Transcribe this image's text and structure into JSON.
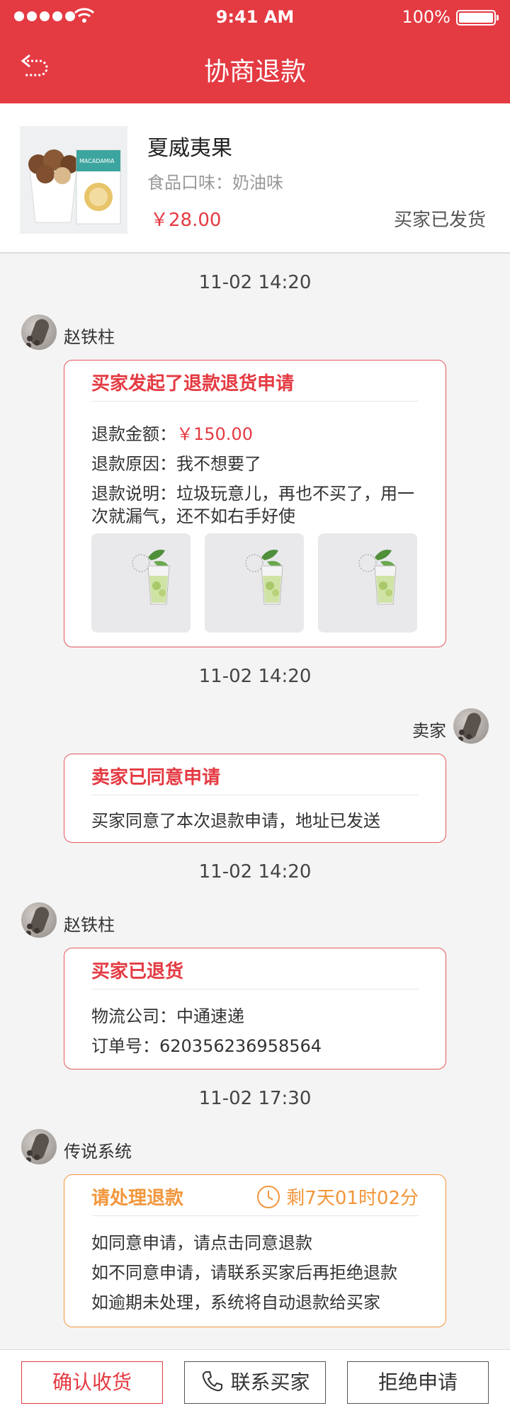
{
  "status": {
    "time": "9:41 AM",
    "battery": "100%"
  },
  "header": {
    "title": "协商退款"
  },
  "product": {
    "name": "夏威夷果",
    "flavor": "食品口味：奶油味",
    "price": "￥28.00",
    "status": "买家已发货",
    "package_text": "MACADAMIA"
  },
  "timeline": [
    {
      "time": "11-02  14:20",
      "sender": "赵铁柱",
      "title": "买家发起了退款退货申请",
      "amount_label": "退款金额：",
      "amount": "￥150.00",
      "reason": "退款原因：我不想要了",
      "desc_line1": "退款说明：垃圾玩意儿，再也不买了，用一",
      "desc_line2": "次就漏气，还不如右手好使"
    },
    {
      "time": "11-02  14:20",
      "sender": "卖家",
      "title": "卖家已同意申请",
      "line1": "买家同意了本次退款申请，地址已发送"
    },
    {
      "time": "11-02  14:20",
      "sender": "赵铁柱",
      "title": "买家已退货",
      "line1": "物流公司：中通速递",
      "line2": "订单号：620356236958564"
    },
    {
      "time": "11-02  17:30",
      "sender": "传说系统",
      "title": "请处理退款",
      "countdown": "剩7天01时02分",
      "line1": "如同意申请，请点击同意退款",
      "line2": "如不同意申请，请联系买家后再拒绝退款",
      "line3": "如逾期未处理，系统将自动退款给买家"
    }
  ],
  "actions": {
    "confirm": "确认收货",
    "contact": "联系买家",
    "reject": "拒绝申请"
  },
  "colors": {
    "brand": "#e43a42",
    "warning": "#f2963b"
  }
}
